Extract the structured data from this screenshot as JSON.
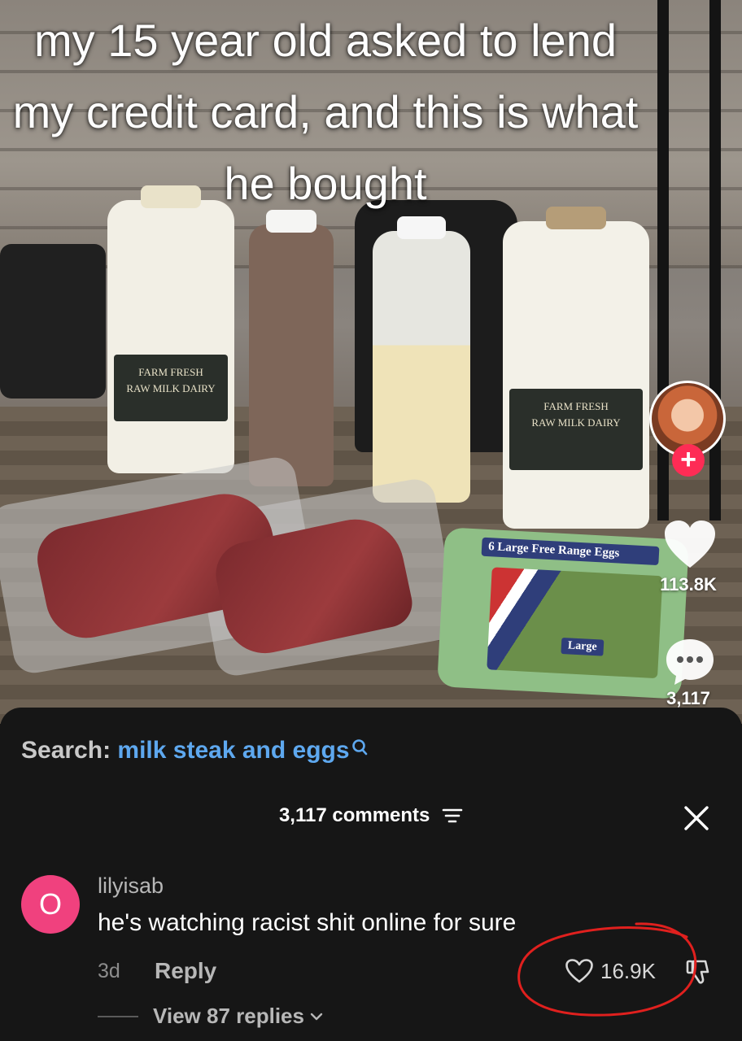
{
  "video": {
    "caption": "my 15 year old asked to lend my credit card, and this is what he bought",
    "product_labels": {
      "milk_brand": "FARM FRESH",
      "milk_line": "RAW MILK DAIRY",
      "eggs_label": "6 Large Free Range Eggs",
      "eggs_size": "Large"
    }
  },
  "actions": {
    "follow_icon": "plus-icon",
    "like_icon": "heart-icon",
    "like_count": "113.8K",
    "comment_icon": "speech-bubble-icon",
    "comment_count": "3,117"
  },
  "sheet": {
    "search_prefix": "Search:",
    "search_term": "milk steak and eggs",
    "comments_count_label": "3,117 comments",
    "close_icon": "close-icon",
    "comment": {
      "avatar_letter": "O",
      "username": "lilyisab",
      "text": "he's watching racist shit online for sure",
      "time": "3d",
      "reply_label": "Reply",
      "like_count": "16.9K",
      "view_replies_label": "View 87 replies"
    }
  },
  "colors": {
    "accent_red": "#fe2c55",
    "link_blue": "#5ea8ef",
    "sheet_bg": "#161616",
    "annotation_red": "#e0201e"
  }
}
